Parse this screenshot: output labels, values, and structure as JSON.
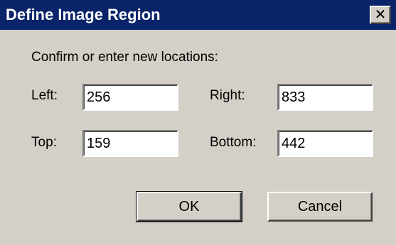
{
  "window": {
    "title": "Define Image Region",
    "close_glyph": "✕"
  },
  "prompt": "Confirm or enter new locations:",
  "fields": {
    "left": {
      "label": "Left:",
      "value": "256"
    },
    "right": {
      "label": "Right:",
      "value": "833"
    },
    "top": {
      "label": "Top:",
      "value": "159"
    },
    "bottom": {
      "label": "Bottom:",
      "value": "442"
    }
  },
  "buttons": {
    "ok": "OK",
    "cancel": "Cancel"
  },
  "colors": {
    "titlebar": "#0a246a",
    "face": "#d4d0c8"
  },
  "icons": {
    "close": "close-icon"
  }
}
